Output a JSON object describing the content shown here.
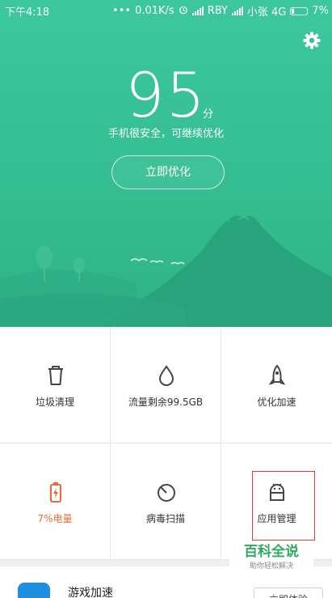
{
  "status_bar": {
    "time": "下午4:18",
    "dots": "•••",
    "speed": "0.01K/s",
    "carrier1": "RBY",
    "carrier2": "小张 4G",
    "battery_text": "7%"
  },
  "header": {
    "score": "95",
    "score_unit": "分",
    "description": "手机很安全，可继续优化",
    "optimize_button": "立即优化",
    "settings_icon": "gear-icon"
  },
  "tools": [
    {
      "label": "垃圾清理",
      "icon": "trash-icon"
    },
    {
      "label": "流量剩余99.5GB",
      "icon": "water-drop-icon"
    },
    {
      "label": "优化加速",
      "icon": "rocket-icon"
    },
    {
      "label": "7%电量",
      "icon": "battery-icon",
      "color": "#ee6a3c"
    },
    {
      "label": "病毒扫描",
      "icon": "scan-icon"
    },
    {
      "label": "应用管理",
      "icon": "android-icon"
    }
  ],
  "bottom": {
    "title": "游戏加速",
    "button": "立即体验"
  },
  "watermark": {
    "title": "百科全说",
    "subtitle": "助你轻松解决"
  },
  "colors": {
    "header_green": "#34bd90",
    "warning": "#ee6a3c",
    "highlight": "#e53935"
  }
}
